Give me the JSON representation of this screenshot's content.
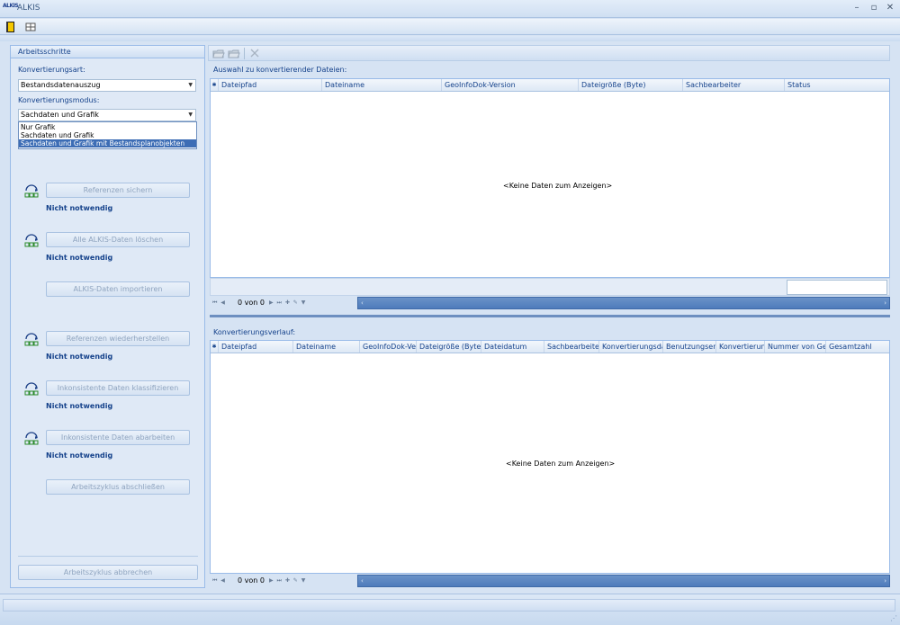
{
  "window": {
    "title": "ALKIS",
    "logo_text": "ALKIS",
    "minimize": "–",
    "maximize": "▫",
    "close": "✕"
  },
  "left": {
    "panel_title": "Arbeitsschritte",
    "conversion_type_label": "Konvertierungsart:",
    "conversion_type_value": "Bestandsdatenauszug",
    "conversion_mode_label": "Konvertierungsmodus:",
    "conversion_mode_value": "Sachdaten und Grafik",
    "mode_options": [
      "Nur Grafik",
      "Sachdaten und Grafik",
      "Sachdaten und Grafik mit Bestandsplanobjekten"
    ],
    "mode_selected_index": 2,
    "steps": [
      {
        "button": "Referenzen sichern",
        "status": "Nicht notwendig"
      },
      {
        "button": "Alle ALKIS-Daten löschen",
        "status": "Nicht notwendig"
      },
      {
        "button": "ALKIS-Daten importieren",
        "status": ""
      },
      {
        "button": "Referenzen wiederherstellen",
        "status": "Nicht notwendig"
      },
      {
        "button": "Inkonsistente Daten klassifizieren",
        "status": "Nicht notwendig"
      },
      {
        "button": "Inkonsistente Daten abarbeiten",
        "status": "Nicht notwendig"
      },
      {
        "button": "Arbeitszyklus abschließen",
        "status": ""
      }
    ],
    "abort_button": "Arbeitszyklus abbrechen"
  },
  "files": {
    "label": "Auswahl zu konvertierender Dateien:",
    "columns": [
      "Dateipfad",
      "Dateiname",
      "GeoInfoDok-Version",
      "Dateigröße (Byte)",
      "Sachbearbeiter",
      "Status"
    ],
    "empty_text": "<Keine Daten zum Anzeigen>",
    "nav_count": "0 von 0"
  },
  "history": {
    "label": "Konvertierungsverlauf:",
    "columns": [
      "Dateipfad",
      "Dateiname",
      "GeoInfoDok-Vers",
      "Dateigröße (Byte)",
      "Dateidatum",
      "Sachbearbeiter",
      "Konvertierungsdat",
      "Benutzungserge",
      "Konvertierung",
      "Nummer von Gesa",
      "Gesamtzahl"
    ],
    "empty_text": "<Keine Daten zum Anzeigen>",
    "nav_count": "0 von 0"
  },
  "colors": {
    "accent": "#15428b",
    "panel_bg": "#dfe9f6",
    "selection": "#3d6db5",
    "scrollbar": "#4e7bbb"
  },
  "icons": [
    "book-icon",
    "grid-icon",
    "open-folder-icon",
    "save-folder-icon",
    "delete-icon",
    "step-cycle-icon"
  ]
}
